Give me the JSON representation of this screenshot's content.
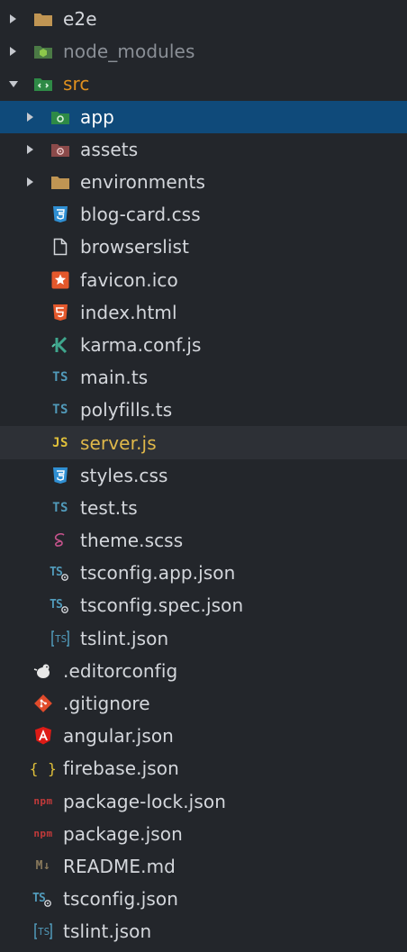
{
  "explorer": {
    "items": [
      {
        "label": "e2e"
      },
      {
        "label": "node_modules"
      },
      {
        "label": "src"
      },
      {
        "label": "app"
      },
      {
        "label": "assets"
      },
      {
        "label": "environments"
      },
      {
        "label": "blog-card.css"
      },
      {
        "label": "browserslist"
      },
      {
        "label": "favicon.ico"
      },
      {
        "label": "index.html"
      },
      {
        "label": "karma.conf.js"
      },
      {
        "label": "main.ts"
      },
      {
        "label": "polyfills.ts"
      },
      {
        "label": "server.js"
      },
      {
        "label": "styles.css"
      },
      {
        "label": "test.ts"
      },
      {
        "label": "theme.scss"
      },
      {
        "label": "tsconfig.app.json"
      },
      {
        "label": "tsconfig.spec.json"
      },
      {
        "label": "tslint.json"
      },
      {
        "label": ".editorconfig"
      },
      {
        "label": ".gitignore"
      },
      {
        "label": "angular.json"
      },
      {
        "label": "firebase.json"
      },
      {
        "label": "package-lock.json"
      },
      {
        "label": "package.json"
      },
      {
        "label": "README.md"
      },
      {
        "label": "tsconfig.json"
      },
      {
        "label": "tslint.json"
      }
    ]
  },
  "icon_glyphs": {
    "ts": "TS",
    "js": "JS",
    "npm": "npm",
    "markdown": "M↓",
    "json_braces": "{ }"
  },
  "colors": {
    "background": "#23262b",
    "selected_row": "#0f4a7a",
    "hover_row": "#2d3036",
    "folder": "#c09553",
    "ts_blue": "#519aba",
    "js_yellow": "#e0c03a",
    "css_blue": "#2f8fd3",
    "html_orange": "#e4582c",
    "angular_red": "#dd1b16",
    "npm_red": "#c23a3a",
    "git_orange": "#e04b2b",
    "src_label": "#e0901e"
  }
}
